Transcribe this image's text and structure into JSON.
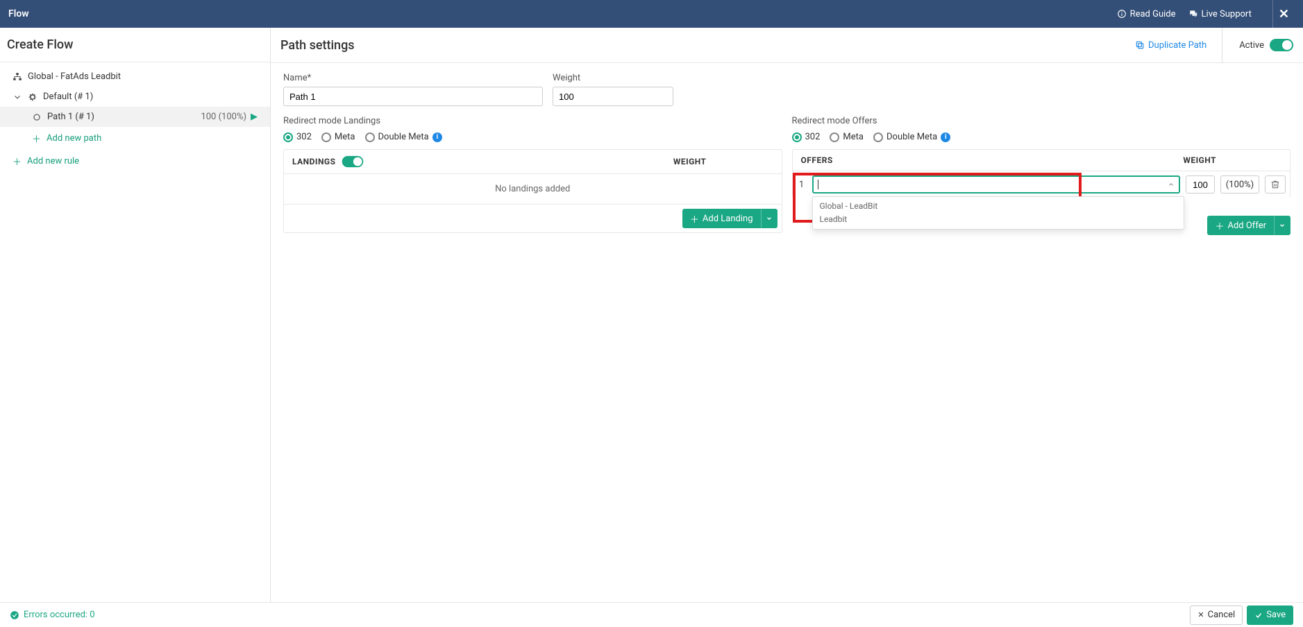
{
  "topbar": {
    "title": "Flow",
    "read_guide": "Read Guide",
    "live_support": "Live Support"
  },
  "left": {
    "title": "Create Flow",
    "campaign": "Global - FatAds Leadbit",
    "group": "Default (# 1)",
    "path": {
      "label": "Path 1 (# 1)",
      "weight": "100 (100%)"
    },
    "add_path": "Add new path",
    "add_rule": "Add new rule"
  },
  "right": {
    "title": "Path settings",
    "duplicate": "Duplicate Path",
    "active_label": "Active"
  },
  "form": {
    "name_label": "Name*",
    "name_value": "Path 1",
    "weight_label": "Weight",
    "weight_value": "100"
  },
  "landings": {
    "redirect_label": "Redirect mode Landings",
    "opt_302": "302",
    "opt_meta": "Meta",
    "opt_double": "Double Meta",
    "col_title": "LANDINGS",
    "col_weight": "WEIGHT",
    "empty": "No landings added",
    "add_btn": "Add Landing"
  },
  "offers": {
    "redirect_label": "Redirect mode Offers",
    "opt_302": "302",
    "opt_meta": "Meta",
    "opt_double": "Double Meta",
    "col_title": "OFFERS",
    "col_weight": "WEIGHT",
    "row_index": "1",
    "row_weight": "100",
    "row_pct": "(100%)",
    "dropdown": {
      "item1": "Global - LeadBit",
      "item2": "Leadbit"
    },
    "add_btn": "Add Offer"
  },
  "footer": {
    "errors": "Errors occurred: 0",
    "cancel": "Cancel",
    "save": "Save"
  }
}
